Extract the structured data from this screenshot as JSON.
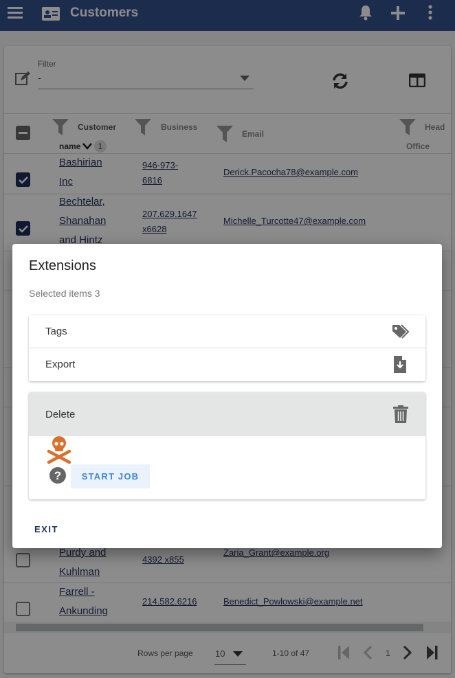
{
  "header": {
    "title": "Customers"
  },
  "filter": {
    "label": "Filter",
    "value": "-"
  },
  "table": {
    "columns": [
      "Customer",
      "name",
      "1",
      "Business",
      "Email",
      "Head",
      "Office"
    ],
    "rows": [
      {
        "name_l1": "Bashirian",
        "name_l2": "Inc",
        "phone_l1": "946-973-",
        "phone_l2": "6816",
        "email": "Derick.Pacocha78@example.com",
        "checked": true
      },
      {
        "name_l1": "Bechtelar,",
        "name_l2": "Shanahan",
        "name_l3": "and Hintz",
        "phone_l1": "207.629.1647",
        "phone_l2": "x6628",
        "email": "Michelle_Turcotte47@example.com",
        "checked": true
      },
      {
        "name_l1": "Purdy and",
        "name_l2": "Kuhlman",
        "phone_l2": "4392 x855",
        "email": "Zaria_Grant@example.org",
        "checked": false
      },
      {
        "name_l1": "Farrell -",
        "name_l2": "Ankunding",
        "phone_l1": "214.582.6216",
        "email": "Benedict_Powlowski@example.net",
        "checked": false
      }
    ]
  },
  "footer": {
    "rows_per_page_label": "Rows per page",
    "rows_per_page": "10",
    "range": "1-10 of 47",
    "page": "1"
  },
  "dialog": {
    "title": "Extensions",
    "selected": "Selected items 3",
    "items": [
      {
        "label": "Tags",
        "icon": "tags-icon"
      },
      {
        "label": "Export",
        "icon": "file-download-icon"
      }
    ],
    "delete": {
      "label": "Delete",
      "icon": "trash-icon",
      "start_job": "START JOB",
      "danger_icon": "skull-crossbones-icon",
      "danger_color": "#d9702e"
    },
    "exit": "EXIT"
  },
  "colors": {
    "primary": "#34508c",
    "link": "#1e2f5a",
    "accent": "#3d86d8"
  }
}
